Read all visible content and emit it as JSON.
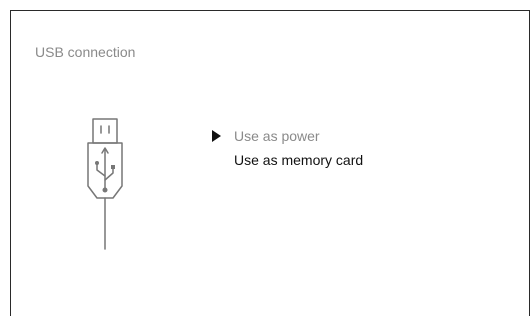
{
  "screen": {
    "title": "USB connection",
    "icon": "usb-plug-icon"
  },
  "menu": {
    "selected_index": 0,
    "options": [
      {
        "label": "Use as power"
      },
      {
        "label": "Use as memory card"
      }
    ]
  },
  "colors": {
    "border": "#2a2a2a",
    "title": "#8a8a8a",
    "selected_text": "#8a8a8a",
    "text": "#111111",
    "icon_stroke": "#777777"
  }
}
